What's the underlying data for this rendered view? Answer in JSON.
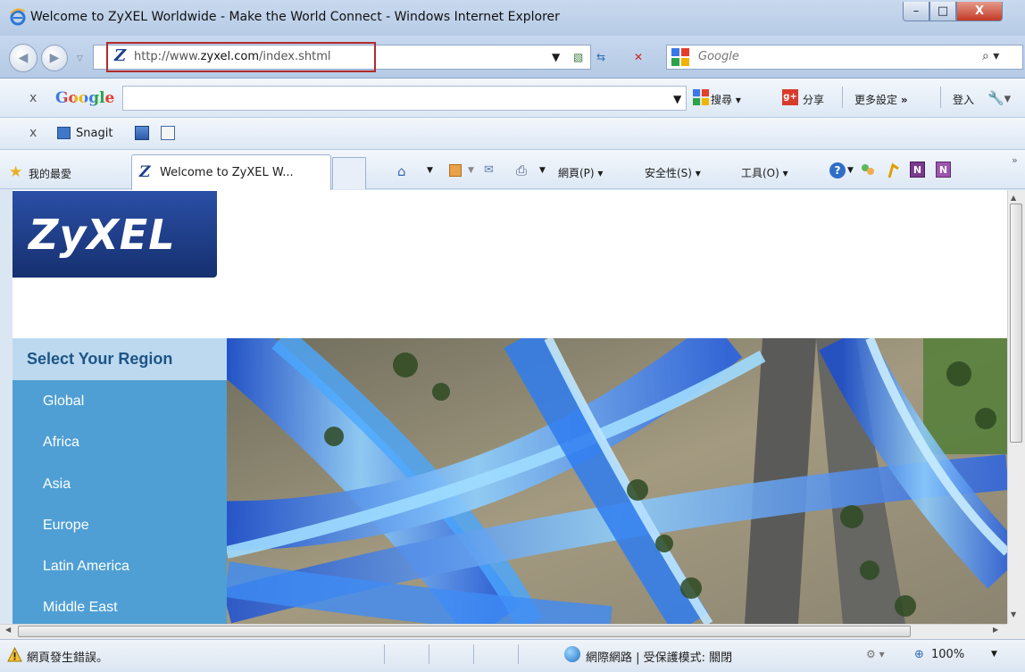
{
  "window": {
    "title": "Welcome to ZyXEL Worldwide - Make the World Connect - Windows Internet Explorer",
    "min_glyph": "–",
    "max_glyph": "□",
    "close_glyph": "X"
  },
  "address": {
    "url_prefix": "http://www.",
    "url_domain": "zyxel.com",
    "url_suffix": "/index.shtml",
    "favicon_letter": "Z"
  },
  "search": {
    "placeholder": "Google"
  },
  "google_toolbar": {
    "close": "x",
    "logo": "Google",
    "search_label": "搜尋",
    "share_label": "分享",
    "more_settings_label": "更多設定",
    "more_settings_arrows": "»",
    "signin_label": "登入"
  },
  "snagit_toolbar": {
    "close": "x",
    "label": "Snagit"
  },
  "favorites_bar": {
    "favorites_label": "我的最愛",
    "tab_title": "Welcome to ZyXEL W...",
    "page_menu": "網頁(P)",
    "safety_menu": "安全性(S)",
    "tools_menu": "工具(O)",
    "overflow": "»"
  },
  "page": {
    "logo_text": "ZyXEL",
    "region_heading": "Select Your Region",
    "regions": [
      "Global",
      "Africa",
      "Asia",
      "Europe",
      "Latin America",
      "Middle East"
    ]
  },
  "statusbar": {
    "status_text": "網頁發生錯誤。",
    "zone_text": "網際網路 | 受保護模式: 關閉",
    "zoom": "100%"
  },
  "colors": {
    "region_list_bg": "#4f9fd4",
    "region_heading_bg": "#bcd9ef",
    "logo_bg": "#16306f",
    "address_highlight": "#b32a2a"
  }
}
